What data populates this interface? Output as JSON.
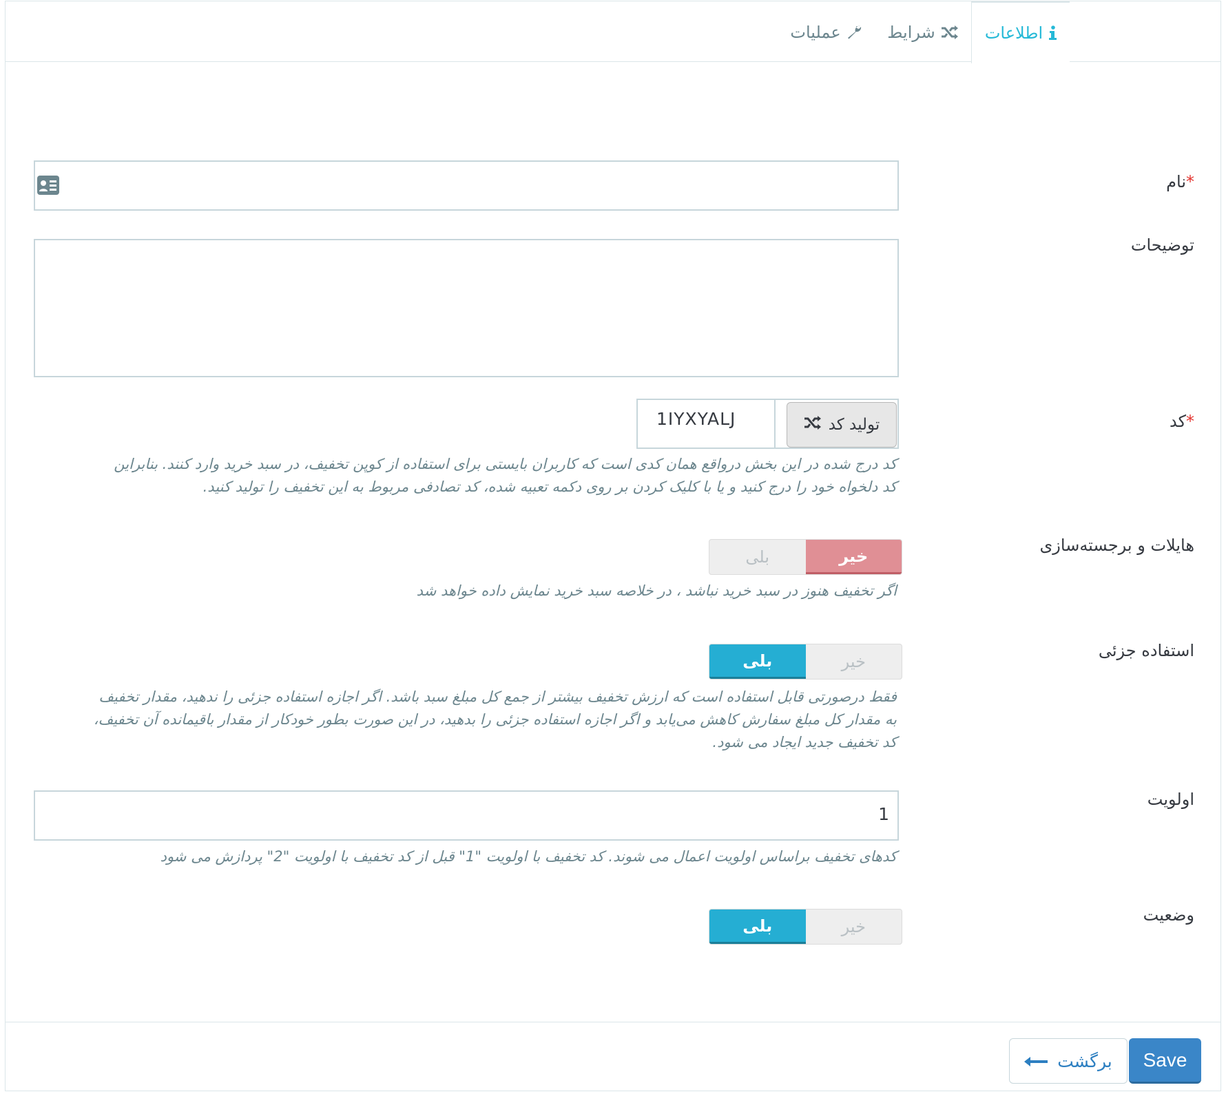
{
  "tabs": [
    {
      "label": "اطلاعات",
      "icon": "info-icon",
      "active": true
    },
    {
      "label": "شرایط",
      "icon": "shuffle-icon",
      "active": false
    },
    {
      "label": "عملیات",
      "icon": "wrench-icon",
      "active": false
    }
  ],
  "form": {
    "name": {
      "label": "نام",
      "required_mark": "*",
      "value": ""
    },
    "description": {
      "label": "توضیحات",
      "value": ""
    },
    "code": {
      "label": "کد",
      "required_mark": "*",
      "value": "1IYXYALJ",
      "generate_label": "تولید کد",
      "help_line1": "کد درج شده در این بخش درواقع همان کدی است که کاربران بایستی برای استفاده از کوپن تخفیف، در سبد خرید وارد کنند. بنابراین",
      "help_line2": "کد دلخواه خود را درج کنید و یا با کلیک کردن بر روی دکمه تعبیه شده، کد تصادفی مربوط به این تخفیف را تولید کنید."
    },
    "highlight": {
      "label": "هایلات و برجسته‌سازی",
      "no": "خیر",
      "yes": "بلی",
      "selected": "خیر",
      "help": "اگر تخفیف هنوز در سبد خرید نباشد ، در خلاصه سبد خرید نمایش داده خواهد شد"
    },
    "partial_use": {
      "label": "استفاده جزئی",
      "no": "خیر",
      "yes": "بلی",
      "selected": "بلی",
      "help_line1": "فقط درصورتی قابل استفاده است که ارزش تخفیف بیشتر از جمع کل مبلغ سبد باشد. اگر اجازه استفاده جزئی را ندهید، مقدار تخفیف",
      "help_line2": "به مقدار کل مبلغ سفارش کاهش می‌یابد و اگر اجازه استفاده جزئی را بدهید، در این صورت بطور خودکار از مقدار باقیمانده آن تخفیف،",
      "help_line3": "کد تخفیف جدید ایجاد می شود."
    },
    "priority": {
      "label": "اولویت",
      "value": "1",
      "help": "کدهای تخفیف براساس اولویت اعمال می شوند. کد تخفیف با اولویت \"1\" قبل از کد تخفیف با اولویت \"2\" پردازش می شود"
    },
    "status": {
      "label": "وضعیت",
      "no": "خیر",
      "yes": "بلی",
      "selected": "بلی"
    }
  },
  "footer": {
    "back_label": "برگشت",
    "save_label": "Save"
  },
  "colors": {
    "accent": "#25b9d7",
    "switch_on_blue": "#25aed3",
    "switch_on_red": "#e08f95",
    "save_button": "#3a86c8",
    "required": "#e3342f"
  }
}
